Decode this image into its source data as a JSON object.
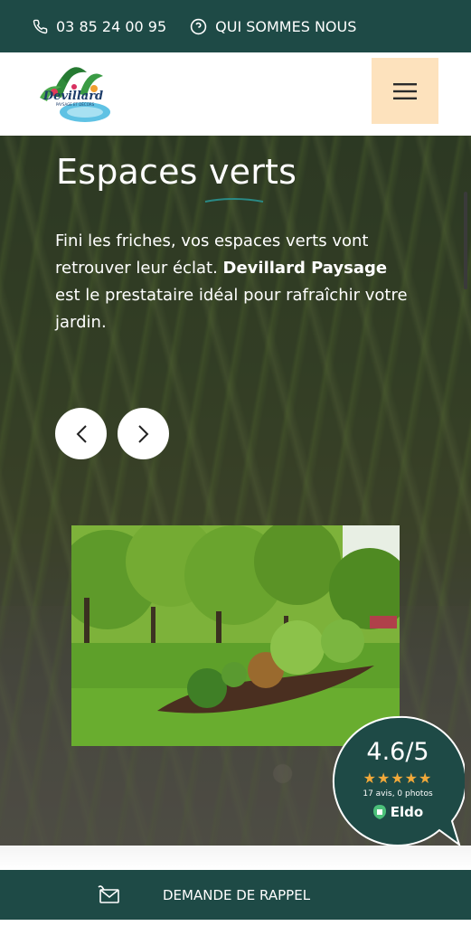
{
  "topbar": {
    "phone": "03 85 24 00 95",
    "about_link": "QUI SOMMES NOUS"
  },
  "header": {
    "logo_name": "Devillard",
    "logo_tagline": "PAYSAGE ET DÉCORS",
    "menu_icon": "hamburger-icon"
  },
  "hero": {
    "title": "Espaces verts",
    "text_before": "Fini les friches, vos espaces verts vont retrouver leur éclat. ",
    "text_bold": "Devillard Paysage",
    "text_after": " est le prestataire idéal pour rafraîchir votre jardin.",
    "prev_icon": "chevron-left-icon",
    "next_icon": "chevron-right-icon"
  },
  "rating": {
    "score": "4.6/5",
    "stars": "★★★★★",
    "stars_value": 4.6,
    "count": "17 avis, 0 photos",
    "brand": "Eldo"
  },
  "callback": {
    "label": "DEMANDE DE RAPPEL",
    "icon": "envelope-phone-icon"
  },
  "colors": {
    "primary": "#1e4a46",
    "menu_bg": "#fde2bd",
    "star": "#f1a93a",
    "accent_line": "#2a8a86"
  }
}
